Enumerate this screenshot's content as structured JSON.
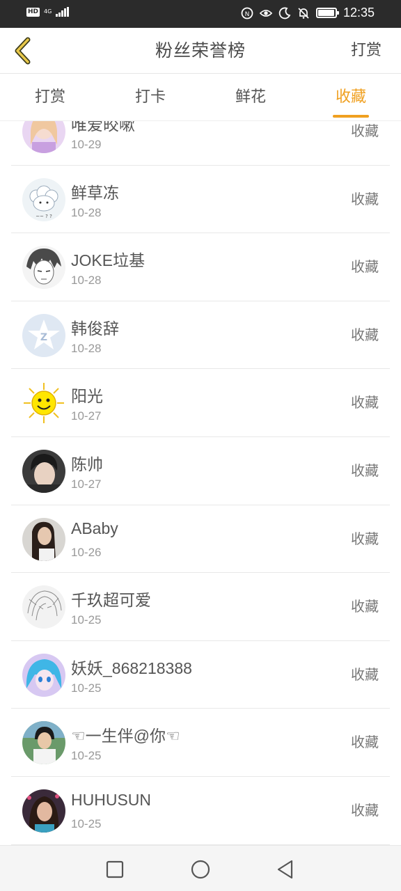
{
  "status_bar": {
    "hd": "HD",
    "network": "4G",
    "time": "12:35",
    "icons": [
      "nfc-icon",
      "eye-icon",
      "moon-icon",
      "bell-off-icon",
      "battery-icon"
    ],
    "battery_level": 0.95
  },
  "header": {
    "title": "粉丝荣誉榜",
    "action_label": "打赏",
    "back_icon": "chevron-left-icon"
  },
  "tabs": [
    {
      "label": "打赏",
      "active": false
    },
    {
      "label": "打卡",
      "active": false
    },
    {
      "label": "鲜花",
      "active": false
    },
    {
      "label": "收藏",
      "active": true
    }
  ],
  "list": {
    "items": [
      {
        "name": "唯爱皎嗽",
        "date": "10-29",
        "action": "收藏",
        "avatar": "anime-girl-pink"
      },
      {
        "name": "鲜草冻",
        "date": "10-28",
        "action": "收藏",
        "avatar": "cartoon-sheep"
      },
      {
        "name": "JOKE垃基",
        "date": "10-28",
        "action": "收藏",
        "avatar": "manga-boy-sketch"
      },
      {
        "name": "韩俊辞",
        "date": "10-28",
        "action": "收藏",
        "avatar": "qzone-star"
      },
      {
        "name": "阳光",
        "date": "10-27",
        "action": "收藏",
        "avatar": "smiling-sun"
      },
      {
        "name": "陈帅",
        "date": "10-27",
        "action": "收藏",
        "avatar": "boy-photo"
      },
      {
        "name": "ABaby",
        "date": "10-26",
        "action": "收藏",
        "avatar": "woman-photo"
      },
      {
        "name": "千玖超可爱",
        "date": "10-25",
        "action": "收藏",
        "avatar": "manga-girl-sketch"
      },
      {
        "name": "妖妖_868218388",
        "date": "10-25",
        "action": "收藏",
        "avatar": "anime-blue-hair"
      },
      {
        "name": "☜一生伴@你☜",
        "date": "10-25",
        "action": "收藏",
        "avatar": "boy-outdoor-photo"
      },
      {
        "name": "HUHUSUN",
        "date": "10-25",
        "action": "收藏",
        "avatar": "girl-photo"
      }
    ]
  },
  "nav_bar": {
    "buttons": [
      "recent-apps-icon",
      "home-icon",
      "back-triangle-icon"
    ]
  },
  "colors": {
    "accent": "#f0a020",
    "status_bar": "#2b2b2b",
    "text": "#555555",
    "secondary_text": "#999999"
  }
}
